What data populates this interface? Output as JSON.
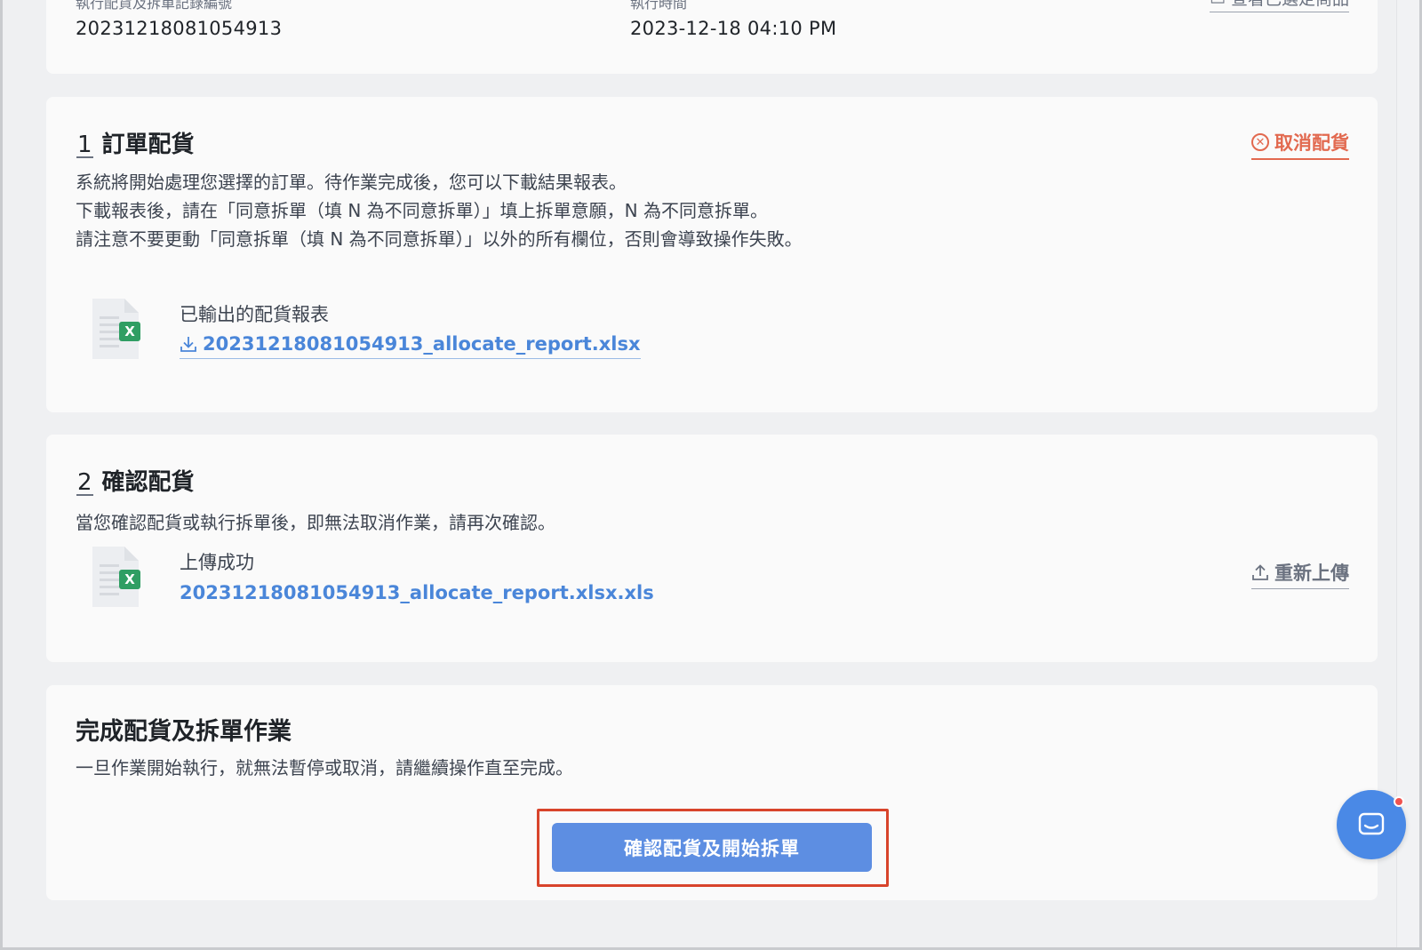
{
  "top_card": {
    "id_label": "執行配貨及拆單記錄編號",
    "id_value": "20231218081054913",
    "time_label": "執行時間",
    "time_value": "2023-12-18 04:10 PM",
    "view_selected_label": "查看已選定商品"
  },
  "step1": {
    "number": "1",
    "title": "訂單配貨",
    "cancel_label": "取消配貨",
    "desc_lines": [
      "系統將開始處理您選擇的訂單。待作業完成後，您可以下載結果報表。",
      "下載報表後，請在「同意拆單（填 N 為不同意拆單）」填上拆單意願，N 為不同意拆單。",
      "請注意不要更動「同意拆單（填 N 為不同意拆單）」以外的所有欄位，否則會導致操作失敗。"
    ],
    "file_label": "已輸出的配貨報表",
    "file_name": "20231218081054913_allocate_report.xlsx"
  },
  "step2": {
    "number": "2",
    "title": "確認配貨",
    "desc": "當您確認配貨或執行拆單後，即無法取消作業，請再次確認。",
    "file_label": "上傳成功",
    "file_name": "20231218081054913_allocate_report.xlsx.xls",
    "reupload_label": "重新上傳"
  },
  "final": {
    "title": "完成配貨及拆單作業",
    "desc": "一旦作業開始執行，就無法暫停或取消，請繼續操作直至完成。",
    "confirm_button": "確認配貨及開始拆單"
  },
  "icons": {
    "file": "excel-file-icon",
    "download": "download-icon",
    "upload": "upload-icon",
    "cancel": "cancel-circle-icon",
    "chat": "chat-icon"
  },
  "colors": {
    "accent": "#5d8ee2",
    "link": "#4a86d9",
    "danger": "#e2694f",
    "highlight": "#d8442b"
  }
}
